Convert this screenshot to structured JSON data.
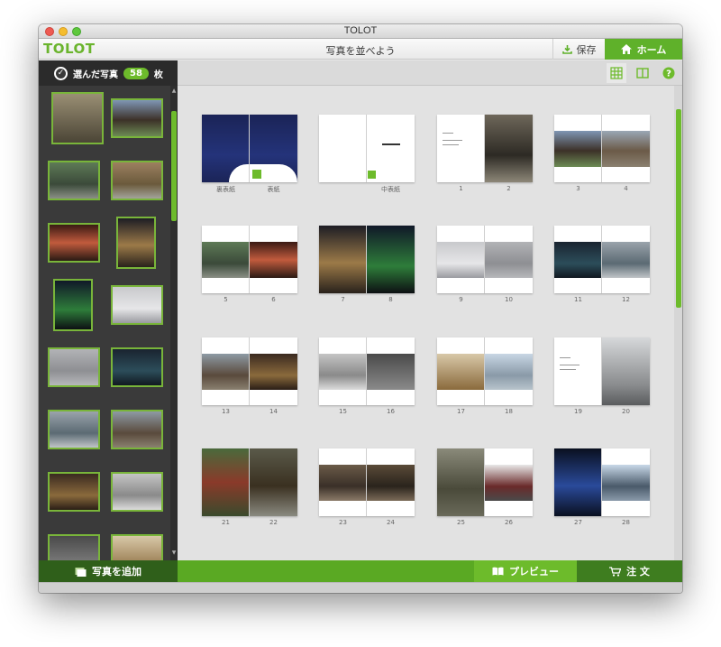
{
  "window": {
    "title": "TOLOT"
  },
  "toolbar": {
    "logo": "TOLOT",
    "page_title": "写真を並べよう",
    "save_label": "保存",
    "home_label": "ホーム"
  },
  "sidebar": {
    "header_label": "選んだ写真",
    "count": "58",
    "count_unit": "枚",
    "add_label": "写真を追加"
  },
  "bottom": {
    "preview_label": "プレビュー",
    "order_label": "注 文"
  },
  "spreads": [
    {
      "left": "裏表紙",
      "right": "表紙"
    },
    {
      "left": "",
      "right": "中表紙"
    },
    {
      "left": "1",
      "right": "2"
    },
    {
      "left": "3",
      "right": "4"
    },
    {
      "left": "5",
      "right": "6"
    },
    {
      "left": "7",
      "right": "8"
    },
    {
      "left": "9",
      "right": "10"
    },
    {
      "left": "11",
      "right": "12"
    },
    {
      "left": "13",
      "right": "14"
    },
    {
      "left": "15",
      "right": "16"
    },
    {
      "left": "17",
      "right": "18"
    },
    {
      "left": "19",
      "right": "20"
    },
    {
      "left": "21",
      "right": "22"
    },
    {
      "left": "23",
      "right": "24"
    },
    {
      "left": "25",
      "right": "26"
    },
    {
      "left": "27",
      "right": "28"
    }
  ],
  "colors": {
    "accent": "#5fb12a",
    "dark_green": "#3e7d1f",
    "sidebar_bg": "#3a3a3a"
  }
}
